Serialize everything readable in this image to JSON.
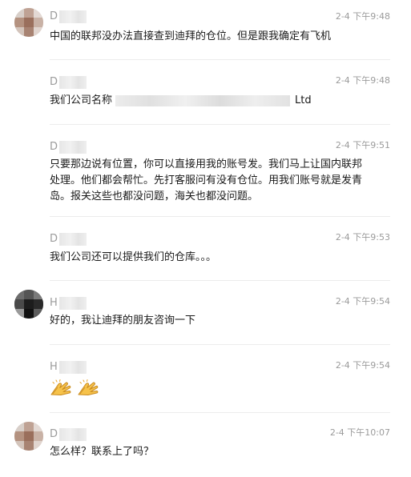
{
  "messages": [
    {
      "sender_initial": "D",
      "time": "2-4 下午9:48",
      "text": "中国的联邦没办法直接查到迪拜的仓位。但是跟我确定有飞机"
    },
    {
      "sender_initial": "D",
      "time": "2-4 下午9:48",
      "text_prefix": "我们公司名称",
      "text_suffix": "Ltd"
    },
    {
      "sender_initial": "D",
      "time": "2-4 下午9:51",
      "text": "只要那边说有位置，你可以直接用我的账号发。我们马上让国内联邦处理。他们都会帮忙。先打客服问有没有仓位。用我们账号就是发青岛。报关这些也都没问题，海关也都没问题。"
    },
    {
      "sender_initial": "D",
      "time": "2-4 下午9:53",
      "text": "我们公司还可以提供我们的仓库。。。"
    },
    {
      "sender_initial": "H",
      "time": "2-4 下午9:54",
      "text": "好的，我让迪拜的朋友咨询一下"
    },
    {
      "sender_initial": "H",
      "time": "2-4 下午9:54",
      "emoji_icons": [
        "clapping-hands-icon",
        "clapping-hands-icon"
      ]
    },
    {
      "sender_initial": "D",
      "time": "2-4 下午10:07",
      "text": "怎么样？联系上了吗？"
    }
  ],
  "colors": {
    "text": "#1a1a1a",
    "meta": "#9b9b9b",
    "divider": "#ececec",
    "emoji": "#f3b33d"
  }
}
